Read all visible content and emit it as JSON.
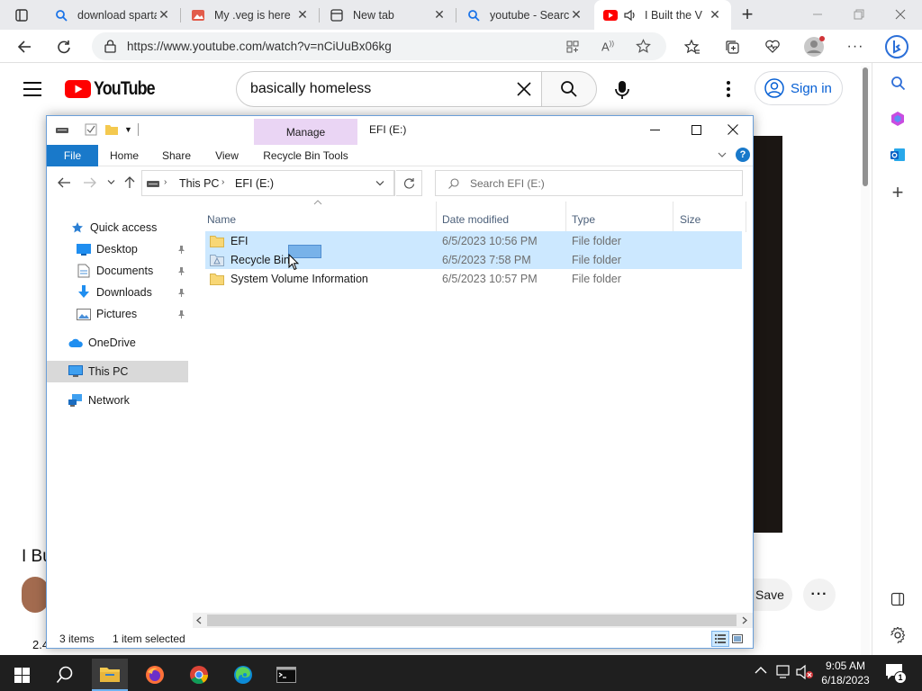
{
  "browser": {
    "tabs": [
      {
        "title": "download sparta",
        "icon": "search-icon"
      },
      {
        "title": "My .veg is here",
        "icon": "image-icon"
      },
      {
        "title": "New tab",
        "icon": "newtab-icon"
      },
      {
        "title": "youtube - Search",
        "icon": "search-icon"
      },
      {
        "title": "I Built the V",
        "icon": "youtube-icon",
        "active": true
      }
    ],
    "url": "https://www.youtube.com/watch?v=nCiUuBx06kg"
  },
  "youtube": {
    "logo_text": "YouTube",
    "search_value": "basically homeless",
    "signin_label": "Sign in",
    "title_fragment": "I Bu",
    "save_label": "Save",
    "views_fragment": "2.4"
  },
  "explorer": {
    "title": "EFI (E:)",
    "manage_label": "Manage",
    "ribbon_tabs": [
      "File",
      "Home",
      "Share",
      "View",
      "Recycle Bin Tools"
    ],
    "breadcrumb": [
      "This PC",
      "EFI (E:)"
    ],
    "search_placeholder": "Search EFI (E:)",
    "columns": [
      "Name",
      "Date modified",
      "Type",
      "Size"
    ],
    "files": [
      {
        "name": "EFI",
        "date": "6/5/2023 10:56 PM",
        "type": "File folder",
        "selected": true
      },
      {
        "name": "Recycle Bin",
        "date": "6/5/2023 7:58 PM",
        "type": "File folder",
        "selected": true
      },
      {
        "name": "System Volume Information",
        "date": "6/5/2023 10:57 PM",
        "type": "File folder",
        "selected": false
      }
    ],
    "nav": {
      "quick_access": "Quick access",
      "desktop": "Desktop",
      "documents": "Documents",
      "downloads": "Downloads",
      "pictures": "Pictures",
      "onedrive": "OneDrive",
      "this_pc": "This PC",
      "network": "Network"
    },
    "status": {
      "items": "3 items",
      "selected": "1 item selected"
    }
  },
  "taskbar": {
    "time": "9:05 AM",
    "date": "6/18/2023",
    "notification_count": "1"
  },
  "colors": {
    "accent": "#0078d4",
    "youtube_red": "#ff0000",
    "selection": "#cce8ff",
    "manage_tab": "#e9d3f2"
  }
}
